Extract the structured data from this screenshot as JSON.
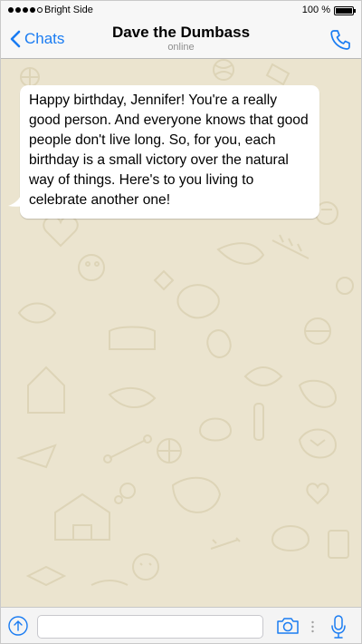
{
  "status_bar": {
    "carrier": "Bright Side",
    "battery": "100 %",
    "battery_level": 1.0,
    "signal_bars_filled": 4,
    "signal_bars_total": 5
  },
  "header": {
    "back_label": "Chats",
    "contact_name": "Dave the Dumbass",
    "contact_status": "online",
    "icons": {
      "back": "chevron-left-icon",
      "call": "phone-icon"
    }
  },
  "messages": [
    {
      "direction": "incoming",
      "text": "Happy birthday, Jennifer! You're a really good person. And everyone knows that good people don't live long. So, for you, each birthday is a small victory over the natural way of things. Here's to you living to celebrate another one!"
    }
  ],
  "input_bar": {
    "placeholder": "",
    "icons": {
      "attach": "upload-icon",
      "camera": "camera-icon",
      "more": "more-dots-icon",
      "mic": "microphone-icon"
    }
  },
  "colors": {
    "accent": "#1a7cf2",
    "chat_background": "#ebe4cf",
    "bubble": "#ffffff",
    "bar_background": "#f7f7f7"
  }
}
